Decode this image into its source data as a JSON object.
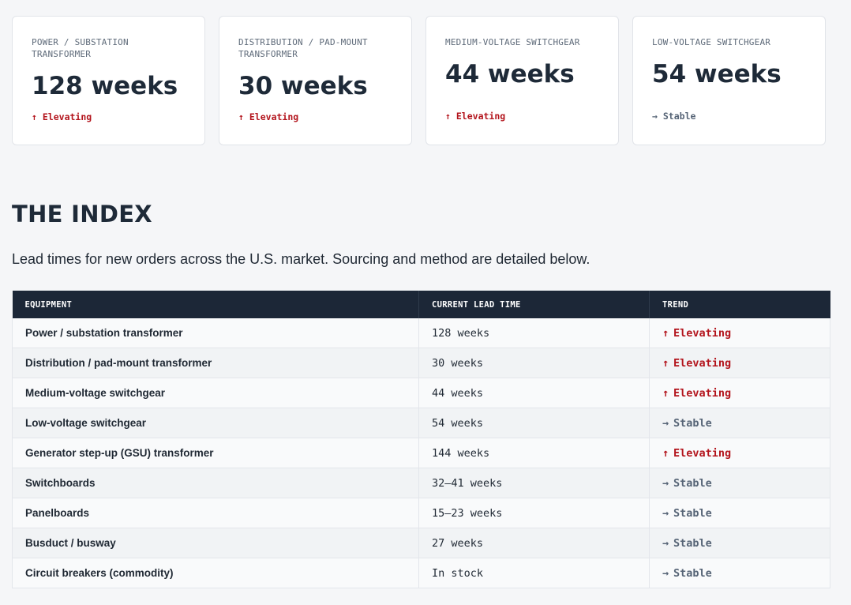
{
  "cards": [
    {
      "label": "POWER / SUBSTATION TRANSFORMER",
      "value": "128 weeks",
      "trend_arrow": "↑",
      "trend_text": "Elevating",
      "trend_type": "up"
    },
    {
      "label": "DISTRIBUTION / PAD-MOUNT TRANSFORMER",
      "value": "30 weeks",
      "trend_arrow": "↑",
      "trend_text": "Elevating",
      "trend_type": "up"
    },
    {
      "label": "MEDIUM-VOLTAGE SWITCHGEAR",
      "value": "44 weeks",
      "trend_arrow": "↑",
      "trend_text": "Elevating",
      "trend_type": "up"
    },
    {
      "label": "LOW-VOLTAGE SWITCHGEAR",
      "value": "54 weeks",
      "trend_arrow": "→",
      "trend_text": "Stable",
      "trend_type": "stable"
    }
  ],
  "index": {
    "title": "THE INDEX",
    "description": "Lead times for new orders across the U.S. market. Sourcing and method are detailed below."
  },
  "table": {
    "headers": {
      "equipment": "EQUIPMENT",
      "lead_time": "CURRENT LEAD TIME",
      "trend": "TREND"
    },
    "rows": [
      {
        "equipment": "Power / substation transformer",
        "lead_time": "128 weeks",
        "trend_arrow": "↑",
        "trend_text": "Elevating",
        "trend_type": "up"
      },
      {
        "equipment": "Distribution / pad-mount transformer",
        "lead_time": "30 weeks",
        "trend_arrow": "↑",
        "trend_text": "Elevating",
        "trend_type": "up"
      },
      {
        "equipment": "Medium-voltage switchgear",
        "lead_time": "44 weeks",
        "trend_arrow": "↑",
        "trend_text": "Elevating",
        "trend_type": "up"
      },
      {
        "equipment": "Low-voltage switchgear",
        "lead_time": "54 weeks",
        "trend_arrow": "→",
        "trend_text": "Stable",
        "trend_type": "stable"
      },
      {
        "equipment": "Generator step-up (GSU) transformer",
        "lead_time": "144 weeks",
        "trend_arrow": "↑",
        "trend_text": "Elevating",
        "trend_type": "up"
      },
      {
        "equipment": "Switchboards",
        "lead_time": "32–41 weeks",
        "trend_arrow": "→",
        "trend_text": "Stable",
        "trend_type": "stable"
      },
      {
        "equipment": "Panelboards",
        "lead_time": "15–23 weeks",
        "trend_arrow": "→",
        "trend_text": "Stable",
        "trend_type": "stable"
      },
      {
        "equipment": "Busduct / busway",
        "lead_time": "27 weeks",
        "trend_arrow": "→",
        "trend_text": "Stable",
        "trend_type": "stable"
      },
      {
        "equipment": "Circuit breakers (commodity)",
        "lead_time": "In stock",
        "trend_arrow": "→",
        "trend_text": "Stable",
        "trend_type": "stable"
      }
    ]
  },
  "colors": {
    "trend_up": "#b3141c",
    "trend_stable": "#566476",
    "header_bg": "#1c2737"
  }
}
